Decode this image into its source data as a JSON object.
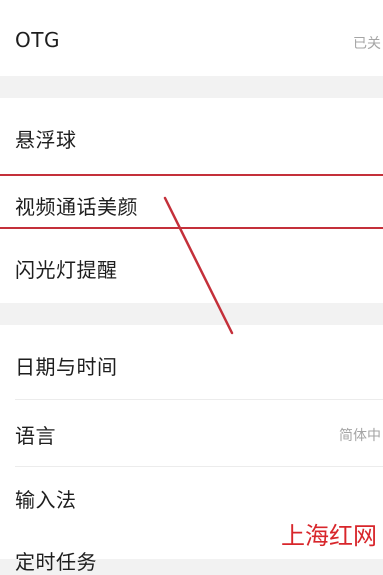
{
  "settings": {
    "otg": {
      "label": "OTG",
      "value": "已关"
    },
    "floating_ball": {
      "label": "悬浮球"
    },
    "video_call_beauty": {
      "label": "视频通话美颜"
    },
    "flash_light_reminder": {
      "label": "闪光灯提醒"
    },
    "date_time": {
      "label": "日期与时间"
    },
    "language": {
      "label": "语言",
      "value": "简体中"
    },
    "input_method": {
      "label": "输入法"
    },
    "scheduled_tasks": {
      "label": "定时任务"
    }
  },
  "annotation": {
    "highlight_color": "#c4303a"
  },
  "watermark": {
    "text": "上海红网",
    "color": "#d8262b"
  }
}
